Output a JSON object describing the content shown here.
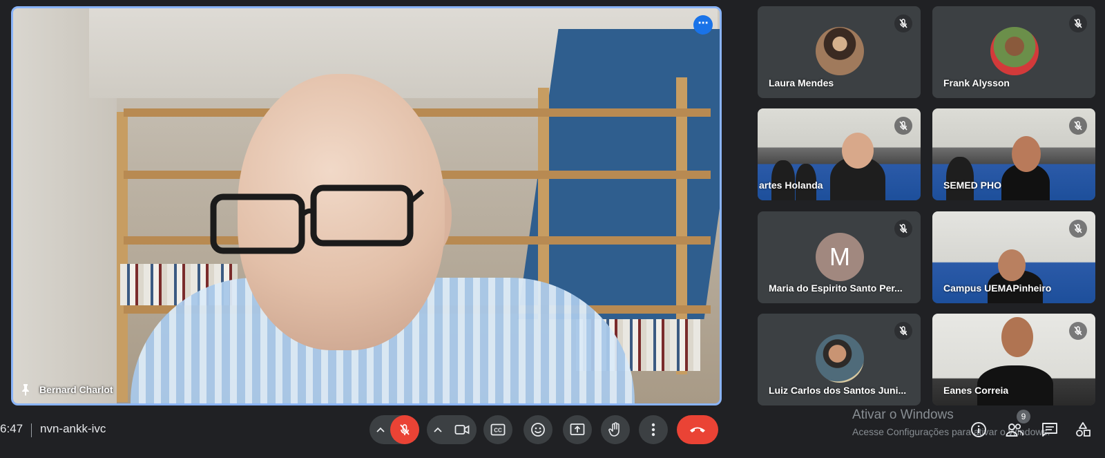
{
  "main_speaker": {
    "name": "Bernard Charlot",
    "more_options_icon": "more-vert-icon",
    "pin_icon": "pin-icon"
  },
  "participants": [
    {
      "name": "Laura Mendes",
      "type": "avatar-photo"
    },
    {
      "name": "Frank Alysson",
      "type": "avatar-photo"
    },
    {
      "name": "artes Holanda",
      "type": "video"
    },
    {
      "name": "SEMED PHO",
      "type": "video"
    },
    {
      "name": "Maria do Espirito Santo Per...",
      "type": "avatar-letter",
      "letter": "M"
    },
    {
      "name": "Campus UEMAPinheiro",
      "type": "video"
    },
    {
      "name": "Luiz Carlos dos Santos Juni...",
      "type": "avatar-photo"
    },
    {
      "name": "Eanes Correia",
      "type": "video"
    }
  ],
  "bottom_bar": {
    "time": "6:47",
    "meeting_code": "nvn-ankk-ivc",
    "participant_count": "9"
  },
  "watermark": {
    "title": "Ativar o Windows",
    "subtitle": "Acesse Configurações para ativar o Windows."
  },
  "colors": {
    "background": "#202124",
    "tile": "#3c4043",
    "accent": "#8ab4f8",
    "danger": "#ea4335"
  }
}
